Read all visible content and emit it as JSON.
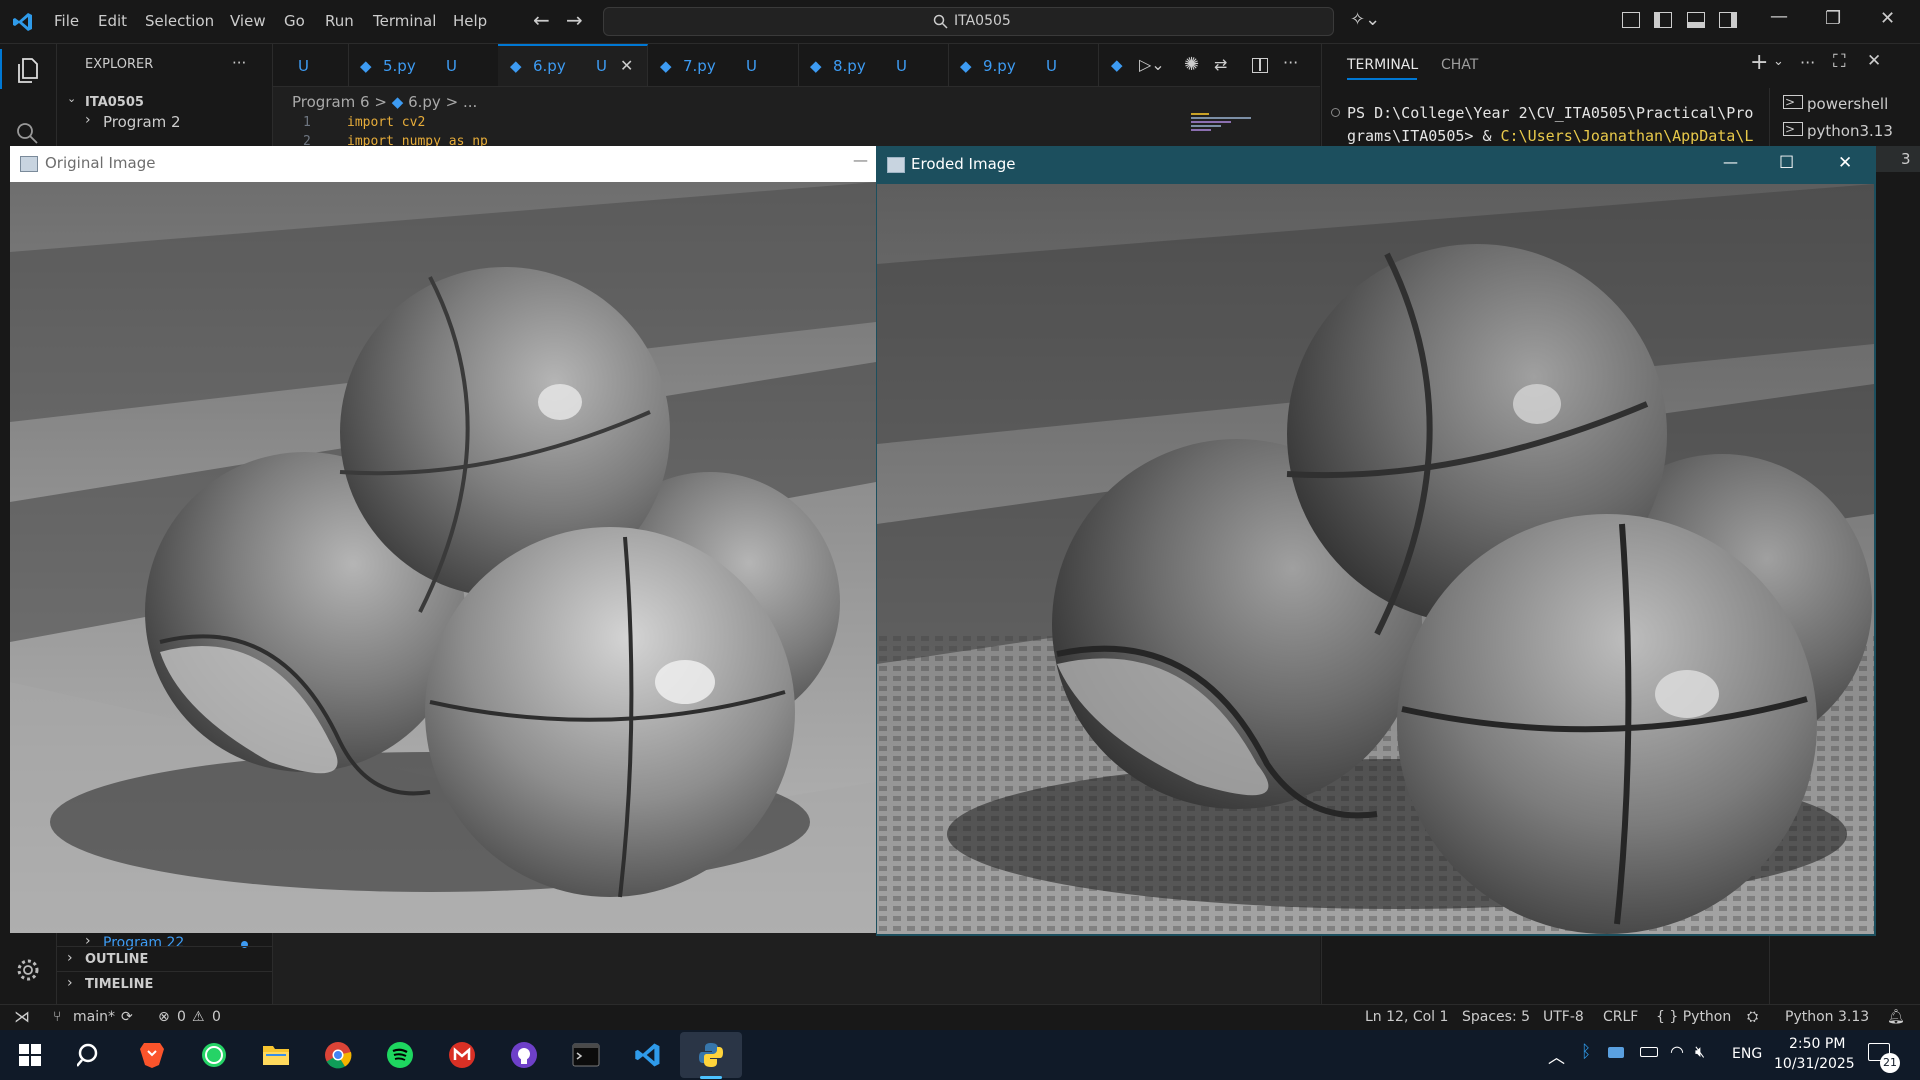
{
  "vscode": {
    "menu": [
      "File",
      "Edit",
      "Selection",
      "View",
      "Go",
      "Run",
      "Terminal",
      "Help"
    ],
    "search": "ITA0505",
    "explorer_title": "EXPLORER",
    "explorer_more": "···",
    "root_folder": "ITA0505",
    "tree": [
      "Program 2",
      "Program 22"
    ],
    "outline": "OUTLINE",
    "timeline": "TIMELINE",
    "tabs": [
      {
        "label": "",
        "status": "U"
      },
      {
        "label": "5.py",
        "status": "U"
      },
      {
        "label": "6.py",
        "status": "U",
        "active": true
      },
      {
        "label": "7.py",
        "status": "U"
      },
      {
        "label": "8.py",
        "status": "U"
      },
      {
        "label": "9.py",
        "status": "U"
      }
    ],
    "breadcrumb": [
      "Program 6",
      ">",
      "6.py",
      ">",
      "..."
    ],
    "code_lines": [
      {
        "num": "1",
        "text": "import cv2"
      },
      {
        "num": "2",
        "text": "import numpy as np"
      }
    ],
    "panel": {
      "tabs": [
        "TERMINAL",
        "CHAT"
      ],
      "terminal_lines": [
        "PS D:\\College\\Year 2\\CV_ITA0505\\Practical\\Pro",
        "grams\\ITA0505> & "
      ],
      "terminal_path": "C:\\Users\\Joanathan\\AppData\\L",
      "sessions": [
        "powershell",
        "python3.13",
        "3"
      ]
    },
    "status": {
      "branch": "main*",
      "errors": "0",
      "warnings": "0",
      "position": "Ln 12, Col 1",
      "spaces": "Spaces: 5",
      "encoding": "UTF-8",
      "eol": "CRLF",
      "language": "{ } Python",
      "interpreter": "Python 3.13"
    }
  },
  "windows": {
    "original": {
      "title": "Original Image",
      "minimize": "—"
    },
    "eroded": {
      "title": "Eroded Image",
      "minimize": "—",
      "maximize": "☐",
      "close": "✕"
    }
  },
  "taskbar": {
    "apps": [
      "start-icon",
      "search-icon",
      "brave-icon",
      "whatsapp-icon",
      "file-explorer-icon",
      "chrome-icon",
      "spotify-icon",
      "gmail-icon",
      "github-icon",
      "terminal-icon",
      "vscode-icon",
      "python-icon"
    ],
    "lang": "ENG",
    "time": "2:50 PM",
    "date": "10/31/2025",
    "notifications": "21"
  },
  "colors": {
    "accent": "#0078d4",
    "tab_text": "#3d9bf2",
    "eroded_titlebar": "#1c4f5e"
  }
}
